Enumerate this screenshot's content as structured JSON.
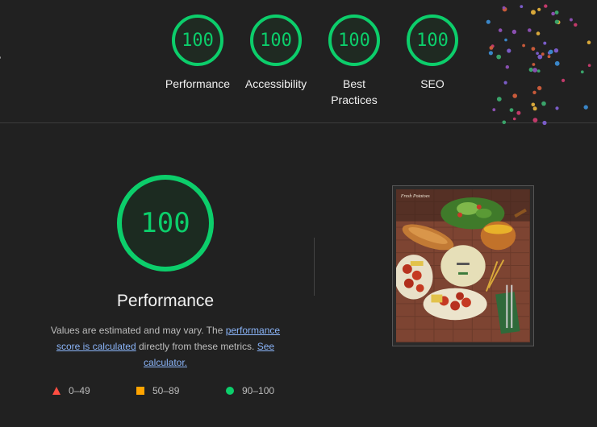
{
  "categories": [
    {
      "score": "100",
      "label": "Performance"
    },
    {
      "score": "100",
      "label": "Accessibility"
    },
    {
      "score": "100",
      "label": "Best Practices"
    },
    {
      "score": "100",
      "label": "SEO"
    }
  ],
  "performance": {
    "score": "100",
    "title": "Performance",
    "desc_prefix": "Values are estimated and may vary. The ",
    "desc_link1": "performance score is calculated",
    "desc_middle": " directly from these metrics. ",
    "desc_link2": "See calculator."
  },
  "legend": [
    {
      "range": "0–49",
      "color": "#ff4e42",
      "icon": "triangle-icon"
    },
    {
      "range": "50–89",
      "color": "#ffa400",
      "icon": "square-icon"
    },
    {
      "range": "90–100",
      "color": "#0cce6b",
      "icon": "circle-icon"
    }
  ],
  "thumbnail": {
    "logo_text": "Fresh Potatoes"
  },
  "colors": {
    "pass": "#0cce6b",
    "average": "#ffa400",
    "fail": "#ff4e42",
    "background": "#212121",
    "link": "#8ab4f8"
  }
}
